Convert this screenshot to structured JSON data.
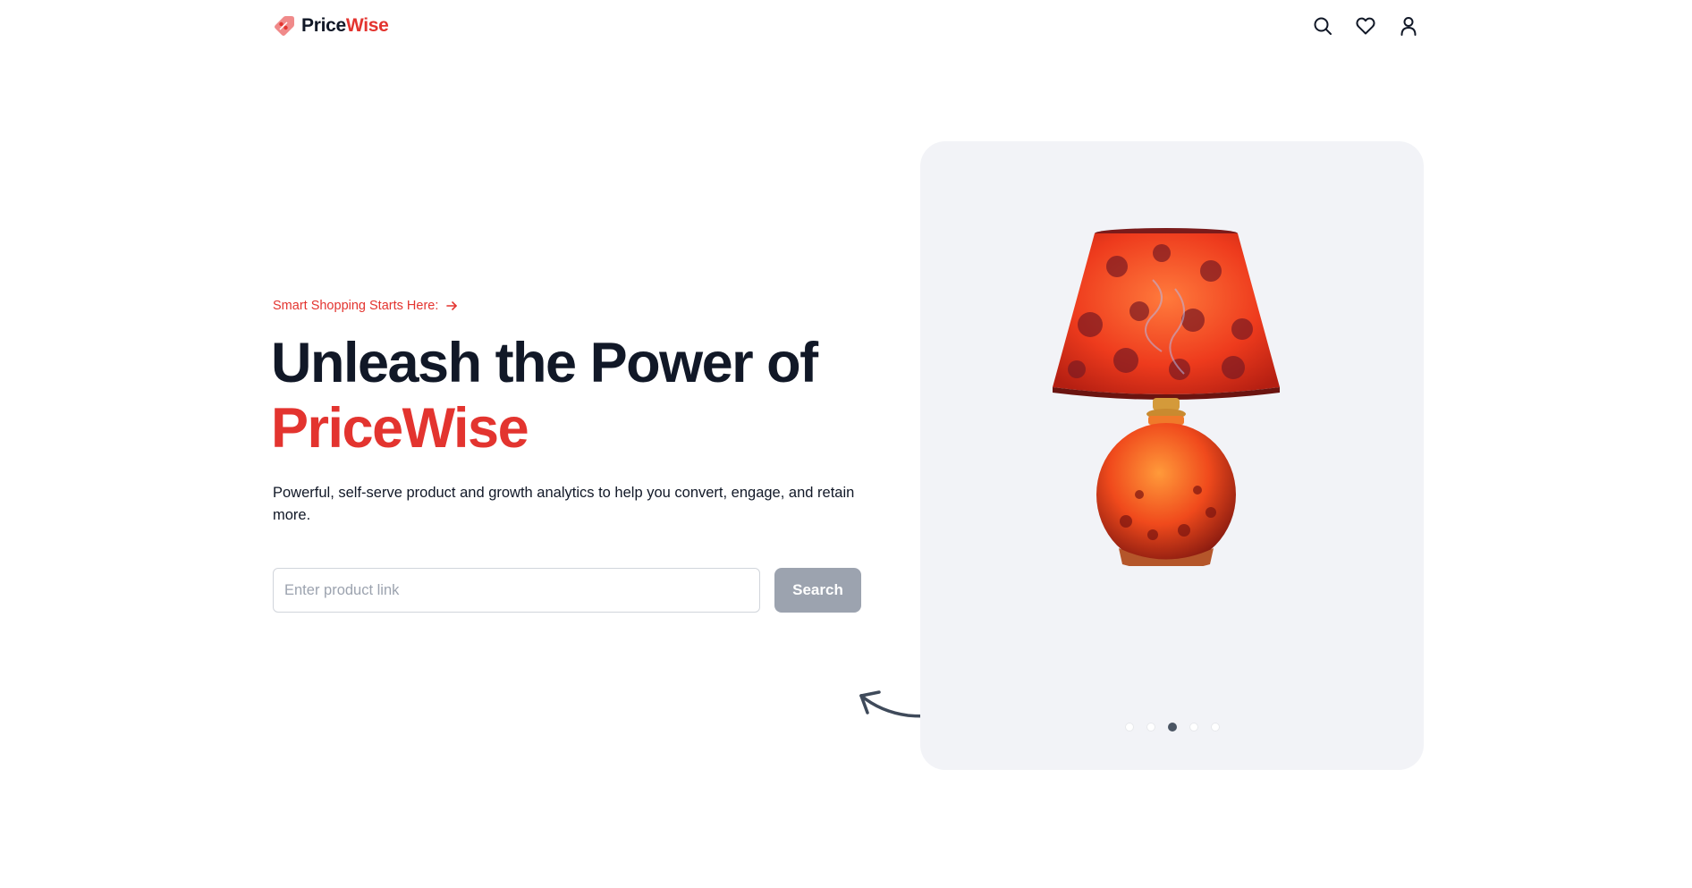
{
  "brand": {
    "name_part1": "Price",
    "name_part2": "Wise",
    "accent_color": "#e3342f"
  },
  "nav": {
    "icons": [
      "search-icon",
      "heart-icon",
      "user-icon"
    ]
  },
  "hero": {
    "tagline": "Smart Shopping Starts Here:",
    "headline_line1": "Unleash the Power of",
    "headline_line2": "PriceWise",
    "subtitle": "Powerful, self-serve product and growth analytics to help you convert, engage, and retain more."
  },
  "search": {
    "placeholder": "Enter product link",
    "value": "",
    "button_label": "Search"
  },
  "carousel": {
    "image": "table-lamp",
    "dot_count": 5,
    "active_index": 2
  },
  "colors": {
    "text": "#111827",
    "muted_button": "#9ca3af",
    "carousel_bg": "#f2f3f7"
  }
}
